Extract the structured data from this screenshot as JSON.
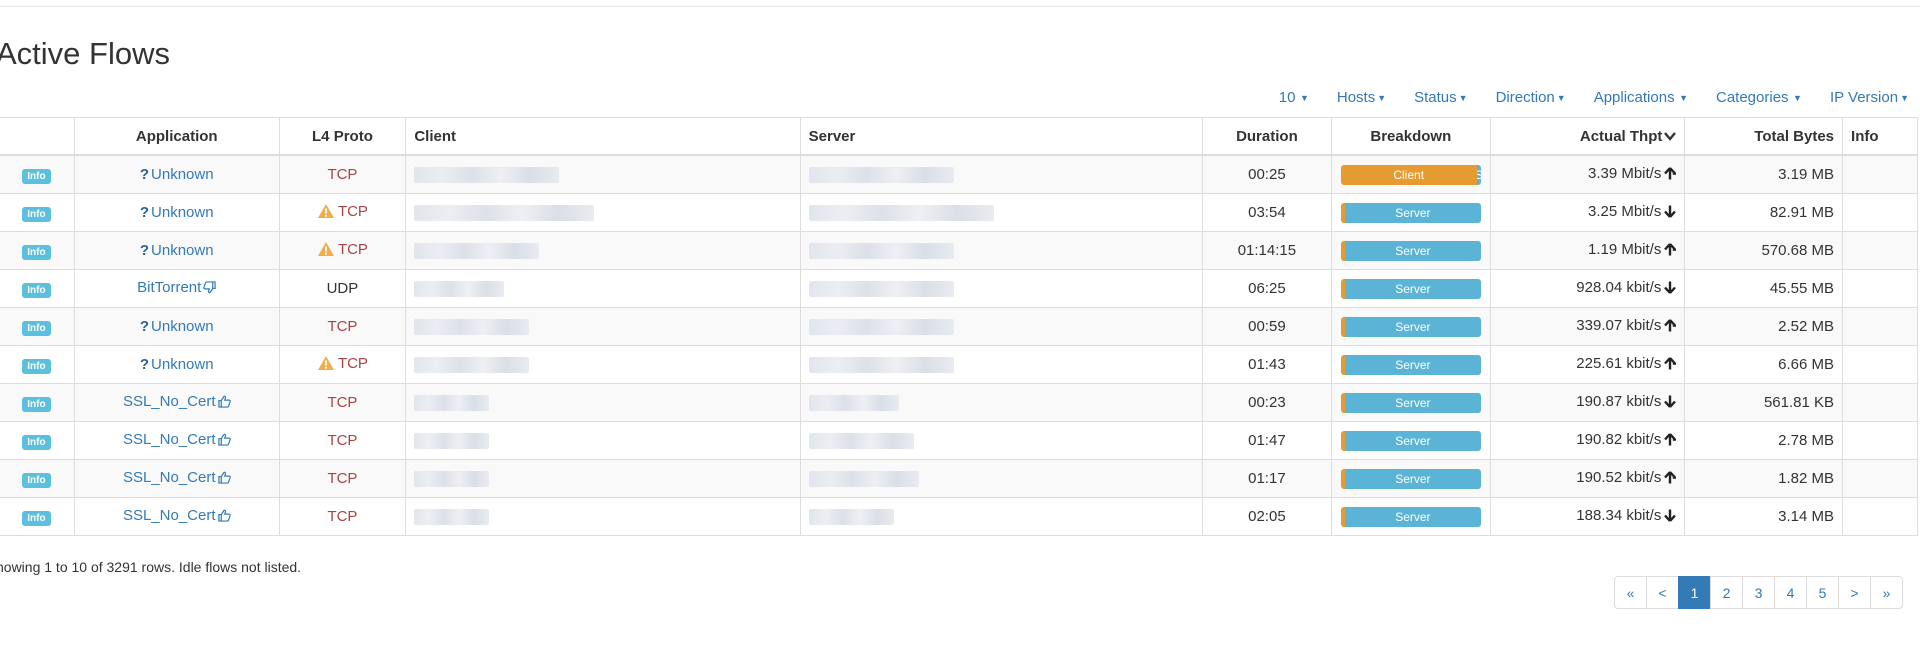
{
  "title": "Active Flows",
  "filters": [
    {
      "label": "10",
      "spaced_caret": true
    },
    {
      "label": "Hosts"
    },
    {
      "label": "Status"
    },
    {
      "label": "Direction"
    },
    {
      "label": "Applications",
      "spaced_caret": true
    },
    {
      "label": "Categories",
      "spaced_caret": true
    },
    {
      "label": "IP Version"
    }
  ],
  "columns": {
    "application": "Application",
    "l4proto": "L4 Proto",
    "client": "Client",
    "server": "Server",
    "duration": "Duration",
    "breakdown": "Breakdown",
    "thpt": "Actual Thpt",
    "bytes": "Total Bytes",
    "info": "Info"
  },
  "info_label": "Info",
  "rows": [
    {
      "app": "Unknown",
      "app_icon": "question-icon",
      "proto": "TCP",
      "warn": false,
      "duration": "00:25",
      "breakdown": {
        "label": "Client",
        "client_pct": 97,
        "tail": "S"
      },
      "thpt": "3.39 Mbit/s",
      "dir": "up",
      "bytes": "3.19 MB"
    },
    {
      "app": "Unknown",
      "app_icon": "question-icon",
      "proto": "TCP",
      "warn": true,
      "duration": "03:54",
      "breakdown": {
        "label": "Server",
        "client_pct": 3
      },
      "thpt": "3.25 Mbit/s",
      "dir": "down",
      "bytes": "82.91 MB"
    },
    {
      "app": "Unknown",
      "app_icon": "question-icon",
      "proto": "TCP",
      "warn": true,
      "duration": "01:14:15",
      "breakdown": {
        "label": "Server",
        "client_pct": 3
      },
      "thpt": "1.19 Mbit/s",
      "dir": "up",
      "bytes": "570.68 MB"
    },
    {
      "app": "BitTorrent",
      "app_icon": "thumbs-down-icon",
      "proto": "UDP",
      "warn": false,
      "duration": "06:25",
      "breakdown": {
        "label": "Server",
        "client_pct": 3
      },
      "thpt": "928.04 kbit/s",
      "dir": "down",
      "bytes": "45.55 MB"
    },
    {
      "app": "Unknown",
      "app_icon": "question-icon",
      "proto": "TCP",
      "warn": false,
      "duration": "00:59",
      "breakdown": {
        "label": "Server",
        "client_pct": 3
      },
      "thpt": "339.07 kbit/s",
      "dir": "up",
      "bytes": "2.52 MB"
    },
    {
      "app": "Unknown",
      "app_icon": "question-icon",
      "proto": "TCP",
      "warn": true,
      "duration": "01:43",
      "breakdown": {
        "label": "Server",
        "client_pct": 3
      },
      "thpt": "225.61 kbit/s",
      "dir": "up",
      "bytes": "6.66 MB"
    },
    {
      "app": "SSL_No_Cert",
      "app_icon": "thumbs-up-icon",
      "proto": "TCP",
      "warn": false,
      "duration": "00:23",
      "breakdown": {
        "label": "Server",
        "client_pct": 3
      },
      "thpt": "190.87 kbit/s",
      "dir": "down",
      "bytes": "561.81 KB"
    },
    {
      "app": "SSL_No_Cert",
      "app_icon": "thumbs-up-icon",
      "proto": "TCP",
      "warn": false,
      "duration": "01:47",
      "breakdown": {
        "label": "Server",
        "client_pct": 3
      },
      "thpt": "190.82 kbit/s",
      "dir": "up",
      "bytes": "2.78 MB"
    },
    {
      "app": "SSL_No_Cert",
      "app_icon": "thumbs-up-icon",
      "proto": "TCP",
      "warn": false,
      "duration": "01:17",
      "breakdown": {
        "label": "Server",
        "client_pct": 3
      },
      "thpt": "190.52 kbit/s",
      "dir": "up",
      "bytes": "1.82 MB"
    },
    {
      "app": "SSL_No_Cert",
      "app_icon": "thumbs-up-icon",
      "proto": "TCP",
      "warn": false,
      "duration": "02:05",
      "breakdown": {
        "label": "Server",
        "client_pct": 3
      },
      "thpt": "188.34 kbit/s",
      "dir": "down",
      "bytes": "3.14 MB"
    }
  ],
  "footer_text": "howing 1 to 10 of 3291 rows. Idle flows not listed.",
  "pagination": {
    "items": [
      "«",
      "<",
      "1",
      "2",
      "3",
      "4",
      "5",
      ">",
      "»"
    ],
    "active": "1"
  },
  "colors": {
    "link": "#337ab7",
    "info_badge": "#5bc0de",
    "client_segment": "#e59b31",
    "server_segment": "#5bb3d6",
    "tcp": "#a94442",
    "warning": "#f0ad4e"
  }
}
